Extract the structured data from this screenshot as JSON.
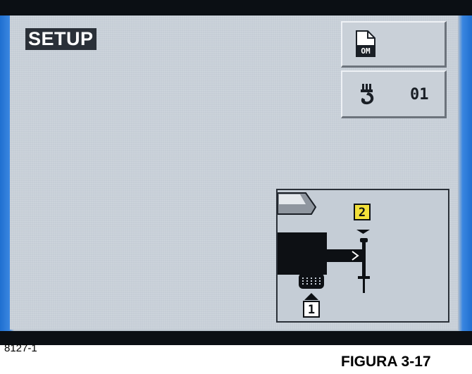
{
  "screen": {
    "mode_label": "SETUP",
    "om_button": {
      "icon": "om-document-icon",
      "icon_text": "OM"
    },
    "hook_button": {
      "icon": "hook-icon",
      "value": "01"
    },
    "diagram": {
      "top_marker": "2",
      "bottom_marker": "1",
      "icons": [
        "cab-icon",
        "boom-icon",
        "winch-drum-icon",
        "hook-block-icon"
      ]
    }
  },
  "caption": {
    "code": "8127-1",
    "figure": "FIGURA 3-17"
  },
  "colors": {
    "screen_bg": "#c5cdd6",
    "label_bg": "#2a3038",
    "marker_yellow": "#f2e03a",
    "bezel_blue": "#1f6fd0"
  }
}
